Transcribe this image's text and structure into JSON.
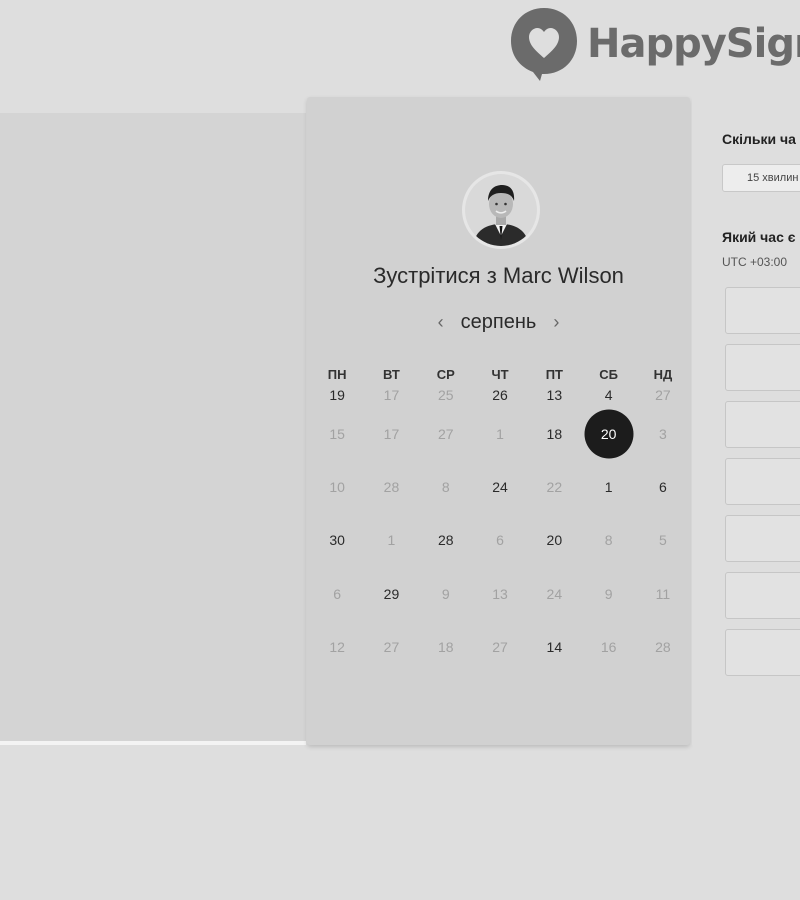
{
  "brand": {
    "logo_text": "HappySign"
  },
  "calendar": {
    "title": "Зустрітися з Marc Wilson",
    "month": "серпень",
    "prev_icon": "‹",
    "next_icon": "›",
    "weekdays": [
      "ПН",
      "ВТ",
      "СР",
      "ЧТ",
      "ПТ",
      "СБ",
      "НД"
    ],
    "selected_day": "20",
    "weeks": [
      [
        {
          "d": "19",
          "s": "avail"
        },
        {
          "d": "17",
          "s": "dim"
        },
        {
          "d": "25",
          "s": "dim"
        },
        {
          "d": "26",
          "s": "avail"
        },
        {
          "d": "13",
          "s": "avail"
        },
        {
          "d": "4",
          "s": "avail"
        },
        {
          "d": "27",
          "s": "dim"
        }
      ],
      [
        {
          "d": "15",
          "s": "dim"
        },
        {
          "d": "17",
          "s": "dim"
        },
        {
          "d": "27",
          "s": "dim"
        },
        {
          "d": "1",
          "s": "dim"
        },
        {
          "d": "18",
          "s": "avail"
        },
        {
          "d": "20",
          "s": "selected"
        },
        {
          "d": "3",
          "s": "dim"
        }
      ],
      [
        {
          "d": "10",
          "s": "dim"
        },
        {
          "d": "28",
          "s": "dim"
        },
        {
          "d": "8",
          "s": "dim"
        },
        {
          "d": "24",
          "s": "avail"
        },
        {
          "d": "22",
          "s": "dim"
        },
        {
          "d": "1",
          "s": "avail"
        },
        {
          "d": "6",
          "s": "avail"
        }
      ],
      [
        {
          "d": "30",
          "s": "avail"
        },
        {
          "d": "1",
          "s": "dim"
        },
        {
          "d": "28",
          "s": "avail"
        },
        {
          "d": "6",
          "s": "dim"
        },
        {
          "d": "20",
          "s": "avail"
        },
        {
          "d": "8",
          "s": "dim"
        },
        {
          "d": "5",
          "s": "dim"
        }
      ],
      [
        {
          "d": "6",
          "s": "dim"
        },
        {
          "d": "29",
          "s": "avail"
        },
        {
          "d": "9",
          "s": "dim"
        },
        {
          "d": "13",
          "s": "dim"
        },
        {
          "d": "24",
          "s": "dim"
        },
        {
          "d": "9",
          "s": "dim"
        },
        {
          "d": "11",
          "s": "dim"
        }
      ],
      [
        {
          "d": "12",
          "s": "dim"
        },
        {
          "d": "27",
          "s": "dim"
        },
        {
          "d": "18",
          "s": "dim"
        },
        {
          "d": "27",
          "s": "dim"
        },
        {
          "d": "14",
          "s": "avail"
        },
        {
          "d": "16",
          "s": "dim"
        },
        {
          "d": "28",
          "s": "dim"
        }
      ]
    ]
  },
  "booking": {
    "duration_question": "Скільки ча",
    "duration_value": "15 хвилин",
    "time_question": "Який час є",
    "timezone": "UTC +03:00",
    "slot_count": 7
  }
}
